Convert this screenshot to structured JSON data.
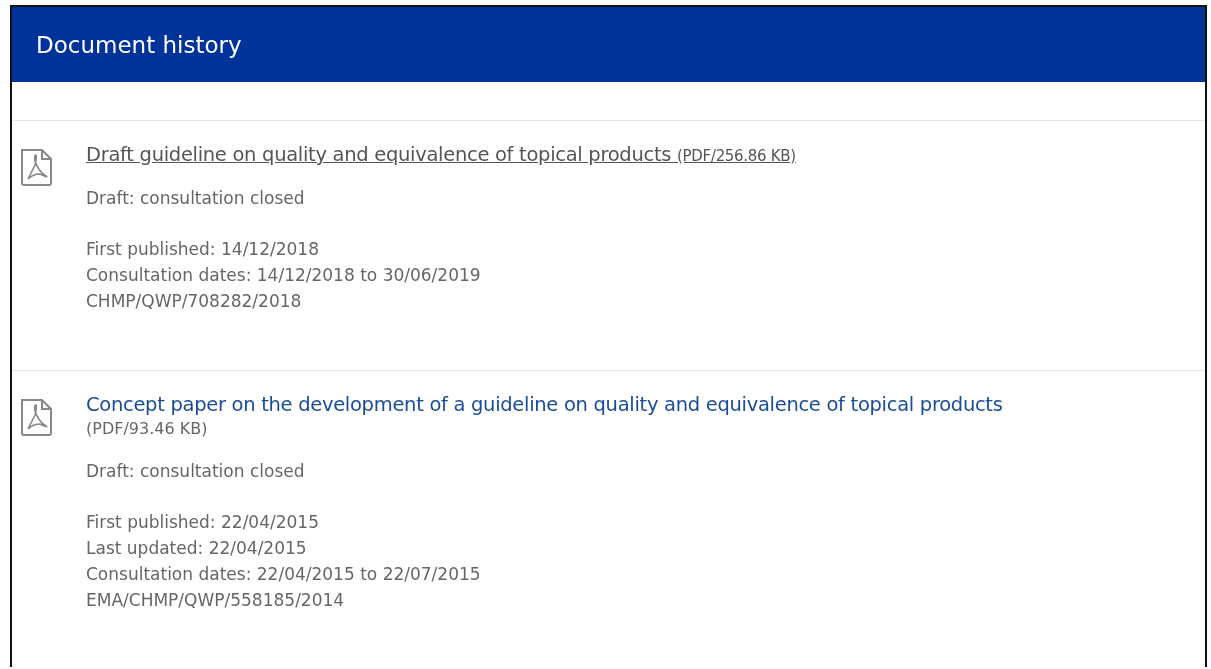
{
  "header": {
    "title": "Document history"
  },
  "documents": [
    {
      "title": "Draft guideline on quality and equivalence of topical products",
      "size": "(PDF/256.86 KB)",
      "visited": true,
      "size_on_new_line": false,
      "status": "Draft: consultation closed",
      "details": [
        "First published: 14/12/2018",
        "Consultation dates: 14/12/2018 to 30/06/2019",
        "CHMP/QWP/708282/2018"
      ]
    },
    {
      "title": "Concept paper on the development of a guideline on quality and equivalence of topical products",
      "size": "(PDF/93.46 KB)",
      "visited": false,
      "size_on_new_line": true,
      "status": "Draft: consultation closed",
      "details": [
        "First published: 22/04/2015",
        "Last updated: 22/04/2015",
        "Consultation dates: 22/04/2015 to 22/07/2015",
        "EMA/CHMP/QWP/558185/2014"
      ]
    }
  ]
}
